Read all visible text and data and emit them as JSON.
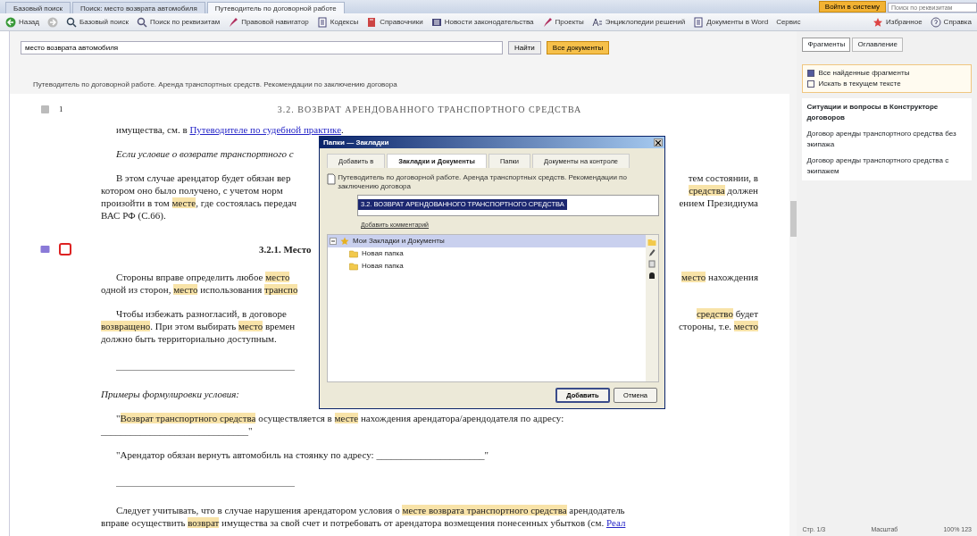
{
  "browser_tabs": [
    {
      "label": "Базовый поиск",
      "selected": false
    },
    {
      "label": "Поиск: место возврата автомобиля",
      "selected": false
    },
    {
      "label": "Путеводитель по договорной работе",
      "selected": true
    }
  ],
  "top_right": {
    "login": "Войти в систему",
    "field_placeholder": "Поиск по реквизитам"
  },
  "toolbar": [
    {
      "label": "Назад",
      "kind": "back"
    },
    {
      "kind": "forward"
    },
    {
      "label": "Базовый поиск",
      "kind": "search"
    },
    {
      "label": "Поиск по реквизитам",
      "kind": "magnifier"
    },
    {
      "label": "Правовой навигатор",
      "kind": "pen"
    },
    {
      "label": "Кодексы",
      "kind": "doc"
    },
    {
      "label": "Справочники",
      "kind": "book"
    },
    {
      "label": "Новости законодательства",
      "kind": "news"
    },
    {
      "label": "Проекты",
      "kind": "pen"
    },
    {
      "label": "Энциклопедии решений",
      "kind": "abc"
    },
    {
      "label": "Документы в Word",
      "kind": "doc"
    },
    {
      "label": "Сервис",
      "kind": "none"
    }
  ],
  "toolbar_right": [
    {
      "label": "Избранное",
      "kind": "star"
    },
    {
      "label": "Справка",
      "kind": "help"
    }
  ],
  "search": {
    "value": "место возврата автомобиля",
    "find": "Найти",
    "advanced": "Все документы"
  },
  "document": {
    "breadcrumb": "Путеводитель по договорной работе. Аренда транспортных средств. Рекомендации по заключению договора",
    "section_number": "1",
    "section_title": "3.2. ВОЗВРАТ АРЕНДОВАННОГО ТРАНСПОРТНОГО СРЕДСТВА",
    "blocks": [
      {
        "kind": "continuation",
        "italic": false,
        "lines": [
          [
            [
              "имущества, см. в ",
              {
                "kind": "link",
                "text": "Путеводителе по судебной практике"
              },
              "."
            ]
          ]
        ]
      },
      {
        "kind": "paragraph",
        "italic": true,
        "lines": [
          [
            [
              "Если условие о возврате транспортного с"
            ]
          ]
        ]
      },
      {
        "kind": "paragraph",
        "italic": false,
        "lines": [
          [
            [
              "В этом случае арендатор будет обязан вер"
            ],
            [
              "тем состоянии, в"
            ]
          ],
          [
            [
              "котором оно было получено, с учетом норм"
            ],
            [
              {
                "kind": "highlight",
                "text": "средства"
              },
              " должен"
            ]
          ],
          [
            [
              "произойти в том ",
              {
                "kind": "highlight",
                "text": "месте"
              },
              ", где состоялась передач"
            ],
            [
              "ением Президиума"
            ]
          ],
          [
            [
              "ВАС РФ (С.66)."
            ]
          ]
        ]
      },
      {
        "kind": "heading",
        "text": "3.2.1. Место"
      },
      {
        "kind": "paragraph",
        "italic": false,
        "lines": [
          [
            [
              "Стороны вправе определить любое ",
              {
                "kind": "highlight",
                "text": "место"
              }
            ],
            [
              {
                "kind": "highlight",
                "text": "место"
              },
              " нахождения"
            ]
          ],
          [
            [
              "одной из сторон, ",
              {
                "kind": "highlight",
                "text": "место"
              },
              " использования ",
              {
                "kind": "highlight",
                "text": "транспо"
              }
            ]
          ]
        ]
      },
      {
        "kind": "paragraph",
        "italic": false,
        "lines": [
          [
            [
              "Чтобы избежать разногласий, в договоре"
            ],
            [
              {
                "kind": "highlight",
                "text": "средство"
              },
              " будет"
            ]
          ],
          [
            [
              {
                "kind": "highlight",
                "text": "возвращено"
              },
              ". При этом выбирать ",
              {
                "kind": "highlight",
                "text": "место"
              },
              " времен"
            ],
            [
              "стороны, т.е. ",
              {
                "kind": "highlight",
                "text": "место"
              }
            ]
          ],
          [
            [
              "должно быть территориально доступным."
            ]
          ]
        ]
      },
      {
        "kind": "separator"
      },
      {
        "kind": "caption",
        "text": "Примеры формулировки условия:"
      },
      {
        "kind": "paragraph",
        "italic": false,
        "lines": [
          [
            [
              "\"",
              {
                "kind": "highlight",
                "text": "Возврат транспортного средства"
              },
              " осуществляется в ",
              {
                "kind": "highlight",
                "text": "месте"
              },
              " нахождения арендатора/арендодателя по адресу:"
            ]
          ],
          [
            [
              "______________________________\""
            ]
          ]
        ]
      },
      {
        "kind": "paragraph",
        "italic": false,
        "lines": [
          [
            [
              "\"Арендатор обязан вернуть автомобиль на стоянку по адресу: ______________________\""
            ]
          ]
        ]
      },
      {
        "kind": "separator"
      },
      {
        "kind": "paragraph",
        "italic": false,
        "lines": [
          [
            [
              "Следует учитывать, что в случае нарушения арендатором условия о ",
              {
                "kind": "highlight",
                "text": "месте возврата транспортного средства"
              },
              " арендодатель"
            ]
          ],
          [
            [
              "вправе осуществить ",
              {
                "kind": "highlight",
                "text": "возврат"
              },
              " имущества за свой счет и потребовать от арендатора возмещения понесенных убытков (см. ",
              {
                "kind": "link",
                "text": "Реал"
              }
            ]
          ]
        ]
      }
    ]
  },
  "dialog": {
    "title": "Папки — Закладки",
    "tabs": [
      {
        "label": "Добавить в",
        "selected": false
      },
      {
        "label": "Закладки и Документы",
        "selected": true
      },
      {
        "label": "Папки",
        "selected": false
      },
      {
        "label": "Документы на контроле",
        "selected": false
      }
    ],
    "document_title": "Путеводитель по договорной работе. Аренда транспортных средств. Рекомендации по заключению договора",
    "fragment": "3.2. ВОЗВРАТ АРЕНДОВАННОГО ТРАНСПОРТНОГО СРЕДСТВА",
    "comment_link": "Добавить комментарий",
    "tree": [
      {
        "label": "Мои Закладки и Документы",
        "kind": "root",
        "selected": true,
        "expanded": true,
        "children": [
          {
            "label": "Новая папка",
            "kind": "folder",
            "selected": false
          },
          {
            "label": "Новая папка",
            "kind": "folder",
            "selected": false
          }
        ]
      }
    ],
    "buttons": [
      {
        "label": "Добавить",
        "kind": "primary"
      },
      {
        "label": "Отмена",
        "kind": "plain"
      }
    ]
  },
  "side_panel": {
    "tabs": [
      {
        "label": "Фрагменты",
        "selected": true
      },
      {
        "label": "Оглавление",
        "selected": false
      }
    ],
    "options": [
      {
        "label": "Все найденные фрагменты",
        "checked": true
      },
      {
        "label": "Искать в текущем тексте",
        "checked": false
      }
    ],
    "heading": "Ситуации и вопросы в Конструкторе договоров",
    "links": [
      "Договор аренды транспортного средства без экипажа",
      "Договор аренды транспортного средства с экипажем"
    ]
  },
  "status_bar": [
    "Стр. 1/3",
    "Масштаб",
    "100% 123"
  ]
}
